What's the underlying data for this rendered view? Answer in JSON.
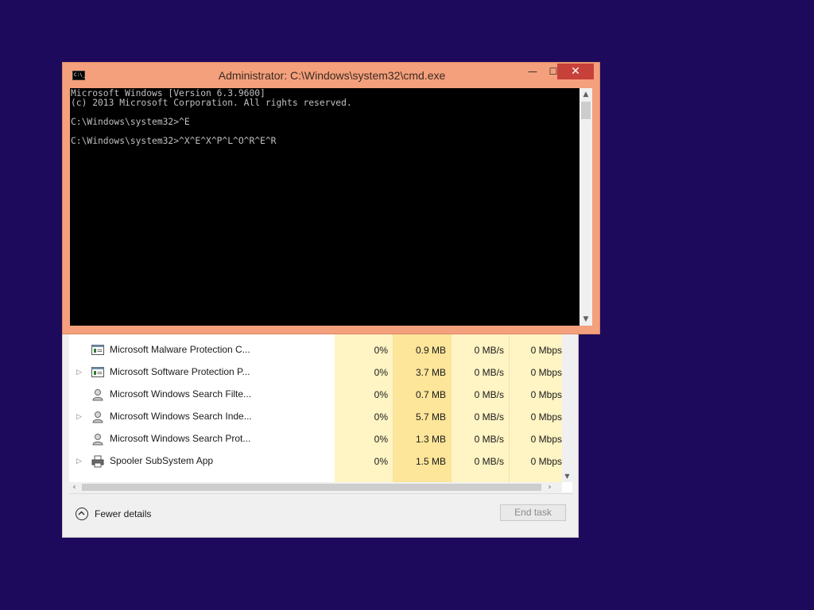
{
  "cmd": {
    "title": "Administrator: C:\\Windows\\system32\\cmd.exe",
    "icon_text": "C:\\_",
    "buttons": {
      "minimize": "—",
      "maximize": "☐",
      "close": "✕"
    },
    "lines": [
      "Microsoft Windows [Version 6.3.9600]",
      "(c) 2013 Microsoft Corporation. All rights reserved.",
      "",
      "C:\\Windows\\system32>^E",
      "",
      "C:\\Windows\\system32>^X^E^X^P^L^O^R^E^R"
    ]
  },
  "taskmanager": {
    "processes": [
      {
        "name": "Microsoft Malware Protection C...",
        "expandable": false,
        "icon": "service-window-icon",
        "cpu": "0%",
        "memory": "0.9 MB",
        "disk": "0 MB/s",
        "network": "0 Mbps"
      },
      {
        "name": "Microsoft Software Protection P...",
        "expandable": true,
        "icon": "service-window-icon",
        "cpu": "0%",
        "memory": "3.7 MB",
        "disk": "0 MB/s",
        "network": "0 Mbps"
      },
      {
        "name": "Microsoft Windows Search Filte...",
        "expandable": false,
        "icon": "search-service-icon",
        "cpu": "0%",
        "memory": "0.7 MB",
        "disk": "0 MB/s",
        "network": "0 Mbps"
      },
      {
        "name": "Microsoft Windows Search Inde...",
        "expandable": true,
        "icon": "search-service-icon",
        "cpu": "0%",
        "memory": "5.7 MB",
        "disk": "0 MB/s",
        "network": "0 Mbps"
      },
      {
        "name": "Microsoft Windows Search Prot...",
        "expandable": false,
        "icon": "search-service-icon",
        "cpu": "0%",
        "memory": "1.3 MB",
        "disk": "0 MB/s",
        "network": "0 Mbps"
      },
      {
        "name": "Spooler SubSystem App",
        "expandable": true,
        "icon": "printer-icon",
        "cpu": "0%",
        "memory": "1.5 MB",
        "disk": "0 MB/s",
        "network": "0 Mbps"
      }
    ],
    "fewer_details_label": "Fewer details",
    "end_task_label": "End task"
  },
  "colors": {
    "desktop": "#1e0a5c",
    "cmd_frame": "#f4a07c",
    "close_button": "#c7413a",
    "column_highlight": "#fff4c4",
    "memory_highlight": "#fde59a"
  }
}
